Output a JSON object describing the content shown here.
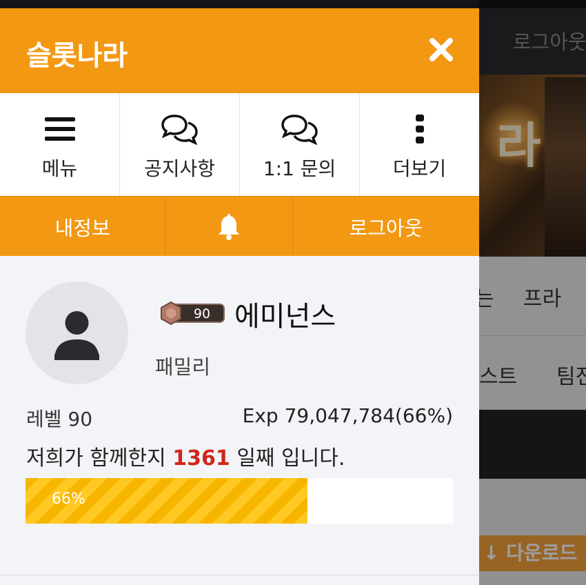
{
  "background": {
    "logout_label": "로그아웃",
    "banner_char": "라",
    "nav_row1": [
      "는",
      "프라"
    ],
    "nav_row2": [
      "스트",
      "팀전"
    ],
    "download_label": "↓ 다운로드"
  },
  "drawer": {
    "title": "슬롯나라",
    "close_icon": "close-icon",
    "quick_menu": [
      {
        "label": "메뉴",
        "icon": "hamburger-icon"
      },
      {
        "label": "공지사항",
        "icon": "chat-bubbles-icon"
      },
      {
        "label": "1:1 문의",
        "icon": "chat-bubbles-icon"
      },
      {
        "label": "더보기",
        "icon": "more-vertical-icon"
      }
    ],
    "orange_bar": {
      "my_info": "내정보",
      "bell_icon": "bell-icon",
      "logout": "로그아웃"
    },
    "profile": {
      "level_badge": "90",
      "nickname": "에미넌스",
      "group": "패밀리",
      "level_text": "레벨 90",
      "exp_text": "Exp 79,047,784(66%)",
      "days_prefix": "저희가 함께한지 ",
      "days_count": "1361",
      "days_suffix": " 일째 입니다.",
      "progress_percent": 66,
      "progress_label": "66%"
    }
  },
  "colors": {
    "accent_orange": "#f39813",
    "progress_yellow": "#f7b500",
    "days_red": "#d0261b"
  }
}
